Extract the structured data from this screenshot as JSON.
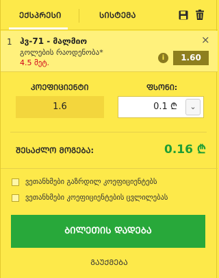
{
  "tabs": {
    "express": "ᲔᲥᲡᲞᲠᲔᲡᲘ",
    "system": "ᲡᲘᲡᲢᲔᲛᲐ"
  },
  "icons": {
    "save": "save-icon",
    "trash": "trash-icon",
    "close": "close-icon",
    "info": "info-icon",
    "dropdown": "chevron-down-icon"
  },
  "bet": {
    "index": "1",
    "match": "ჰვ-71 - მალმიო",
    "market": "გოლების რაოდენობა*",
    "line": "4.5 მეტ.",
    "close": "×",
    "info": "i",
    "odds": "1.60"
  },
  "form": {
    "odds_label": "ᲙᲝᲔᲤᲘᲪᲘᲔᲜᲢᲘ",
    "stake_label": "ᲤᲡᲝᲜᲘ:",
    "odds_value": "1.6",
    "stake_value": "0.1 ₾",
    "stake_arrow": "⌄"
  },
  "payout": {
    "label": "ᲨᲔᲡᲐᲫᲚᲝ ᲛᲝᲒᲔᲑᲐ:",
    "value": "0.16 ₾"
  },
  "options": [
    {
      "label": "ვეთანხმები გაზრდილ კოეფიციენტებს",
      "checked": false
    },
    {
      "label": "ვეთანხმები კოეფიციენტების ცვლილებას",
      "checked": false
    }
  ],
  "actions": {
    "place_bet": "ᲑᲘᲚᲔᲗᲘᲡ ᲓᲐᲓᲔᲑᲐ",
    "cancel": "ᲒᲐᲣᲥᲛᲔᲑᲐ"
  },
  "colors": {
    "background": "#fde94a",
    "accent_green": "#28a83a",
    "payout_green": "#1f9e35",
    "odds_badge": "#8e7f1e",
    "line_red": "#d0021b"
  }
}
